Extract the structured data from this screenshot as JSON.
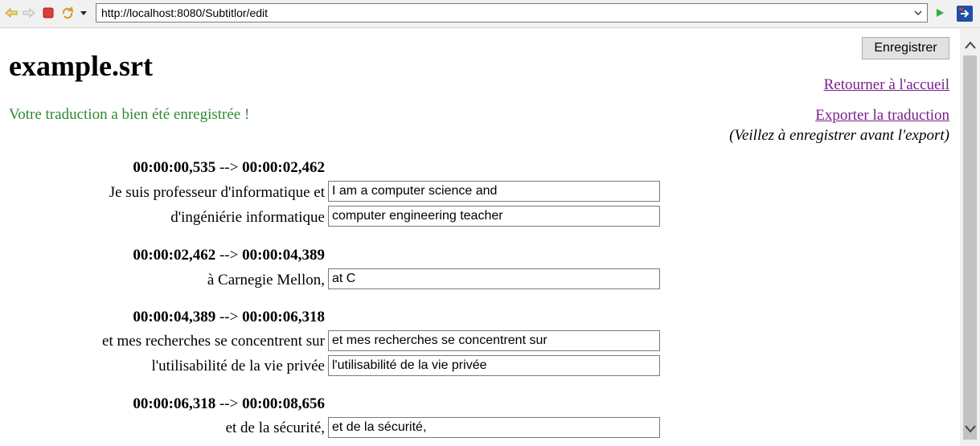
{
  "browser": {
    "url": "http://localhost:8080/Subtitlor/edit",
    "icons": [
      "back-arrow-icon",
      "forward-arrow-icon",
      "stop-icon",
      "refresh-icon",
      "dropdown-icon",
      "go-icon",
      "external-icon"
    ]
  },
  "page": {
    "title": "example.srt",
    "save_label": "Enregistrer",
    "home_link": "Retourner à l'accueil",
    "export_link": "Exporter la traduction",
    "export_note": "(Veillez à enregistrer avant l'export)",
    "success_message": "Votre traduction a bien été enregistrée !"
  },
  "subtitles": [
    {
      "start": "00:00:00,535",
      "arrow": "-->",
      "end": "00:00:02,462",
      "lines": [
        {
          "source": "Je suis professeur d'informatique et",
          "translation": "I am a computer science and"
        },
        {
          "source": "d'ingéniérie informatique",
          "translation": "computer engineering teacher"
        }
      ]
    },
    {
      "start": "00:00:02,462",
      "arrow": "-->",
      "end": "00:00:04,389",
      "lines": [
        {
          "source": "à Carnegie Mellon,",
          "translation": "at C"
        }
      ]
    },
    {
      "start": "00:00:04,389",
      "arrow": "-->",
      "end": "00:00:06,318",
      "lines": [
        {
          "source": "et mes recherches se concentrent sur",
          "translation": "et mes recherches se concentrent sur"
        },
        {
          "source": "l'utilisabilité de la vie privée",
          "translation": "l'utilisabilité de la vie privée"
        }
      ]
    },
    {
      "start": "00:00:06,318",
      "arrow": "-->",
      "end": "00:00:08,656",
      "lines": [
        {
          "source": "et de la sécurité,",
          "translation": "et de la sécurité,"
        }
      ]
    }
  ],
  "colors": {
    "link": "#7b1f8c",
    "success": "#2e8b2e"
  }
}
